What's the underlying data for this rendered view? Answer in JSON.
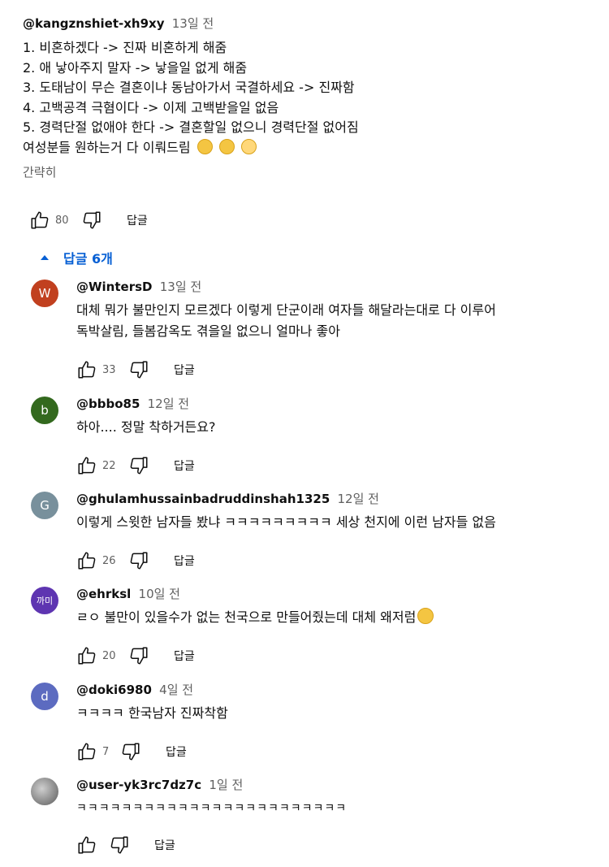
{
  "main_comment": {
    "author": "@kangznshiet-xh9xy",
    "time": "13일 전",
    "lines": [
      "1. 비혼하겠다 -> 진짜 비혼하게 해줌",
      "2. 애 낳아주지 말자 -> 낳을일 없게 해줌",
      "3. 도태남이 무슨 결혼이냐 동남아가서 국결하세요 -> 진짜함",
      "4. 고백공격 극혐이다 -> 이제 고백받을일 없음",
      "5. 경력단절 없애야 한다 -> 결혼할일 없으니 경력단절 없어짐",
      "여성분들 원하는거 다 이뤄드림"
    ],
    "read_less": "간략히",
    "likes": "80",
    "reply_label": "답글"
  },
  "replies_toggle": "답글 6개",
  "replies": [
    {
      "author": "@WintersD",
      "time": "13일 전",
      "avatar_letter": "W",
      "avatar_color": "#c1401f",
      "lines": [
        "대체 뭐가 불만인지 모르겠다  이렇게  단군이래 여자들 해달라는대로 다 이루어",
        "독박살림, 들봄감옥도  겪을일 없으니 얼마나 좋아"
      ],
      "likes": "33",
      "reply_label": "답글"
    },
    {
      "author": "@bbbo85",
      "time": "12일 전",
      "avatar_letter": "b",
      "avatar_color": "#33691e",
      "lines": [
        "하아.... 정말 착하거든요?"
      ],
      "likes": "22",
      "reply_label": "답글"
    },
    {
      "author": "@ghulamhussainbadruddinshah1325",
      "time": "12일 전",
      "avatar_letter": "G",
      "avatar_color": "#78909c",
      "lines": [
        "이렇게 스윗한 남자들 봤냐 ㅋㅋㅋㅋㅋㅋㅋㅋㅋ 세상 천지에 이런 남자들 없음"
      ],
      "likes": "26",
      "reply_label": "답글"
    },
    {
      "author": "@ehrksl",
      "time": "10일 전",
      "avatar_letter": "까미",
      "avatar_color": "#5e35b1",
      "lines": [
        "ㄹㅇ 불만이 있을수가 없는 천국으로 만들어줬는데 대체 왜저럼"
      ],
      "likes": "20",
      "reply_label": "답글"
    },
    {
      "author": "@doki6980",
      "time": "4일 전",
      "avatar_letter": "d",
      "avatar_color": "#5c6bc0",
      "lines": [
        "ㅋㅋㅋㅋ 한국남자 진짜착함"
      ],
      "likes": "7",
      "reply_label": "답글"
    },
    {
      "author": "@user-yk3rc7dz7c",
      "time": "1일 전",
      "avatar_letter": "",
      "avatar_color": "#8d8d8d",
      "lines": [
        "ㅋㅋㅋㅋㅋㅋㅋㅋㅋㅋㅋㅋㅋㅋㅋㅋㅋㅋㅋㅋㅋㅋㅋㅋ"
      ],
      "likes": "",
      "reply_label": "답글"
    }
  ],
  "icons": {
    "like": "thumbs-up-icon",
    "dislike": "thumbs-down-icon",
    "caret": "caret-up-icon"
  },
  "colors": {
    "link_blue": "#065fd4",
    "secondary_text": "#606060"
  }
}
